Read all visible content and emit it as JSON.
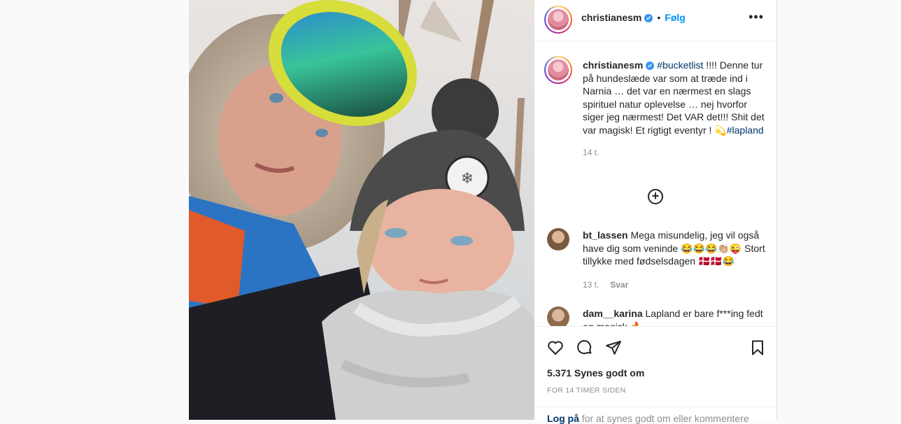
{
  "post": {
    "username": "christianesm",
    "verified_mark": "✔",
    "separator": "•",
    "follow_label": "Følg",
    "more_label": "•••",
    "caption_hashtag": "#bucketlist",
    "caption_text": " !!!! Denne tur på hundeslæde var som at træde ind i Narnia … det var en nærmest en slags spirituel natur oplevelse … nej hvorfor siger jeg nærmest! Det VAR det!!! Shit det var magisk! Et rigtigt eventyr ! 💫",
    "caption_tag_end": "#lapland",
    "caption_time": "14 t.",
    "carousel_next": "›"
  },
  "comments": [
    {
      "username": "bt_lassen",
      "text": " Mega misundelig, jeg vil også have dig som veninde 😂😂😂👏🏼😜 Stort tillykke med fødselsdagen 🇩🇰🇩🇰😂",
      "time": "13 t.",
      "reply_label": "Svar"
    },
    {
      "username": "dam__karina",
      "text": " Lapland er bare f***ing fedt og magisk 🔥"
    }
  ],
  "actions": {
    "likes": "5.371 Synes godt om",
    "posted": "FOR 14 TIMER SIDEN",
    "login_link": "Log på",
    "login_text": " for at synes godt om eller kommentere"
  },
  "icons": {
    "like": "heart-icon",
    "comment": "comment-icon",
    "share": "share-icon",
    "save": "bookmark-icon",
    "load_more": "plus-circle-icon"
  },
  "colors": {
    "accent": "#0095f6",
    "hashtag": "#00376b",
    "muted": "#8e8e8e",
    "verified": "#3897f0"
  }
}
